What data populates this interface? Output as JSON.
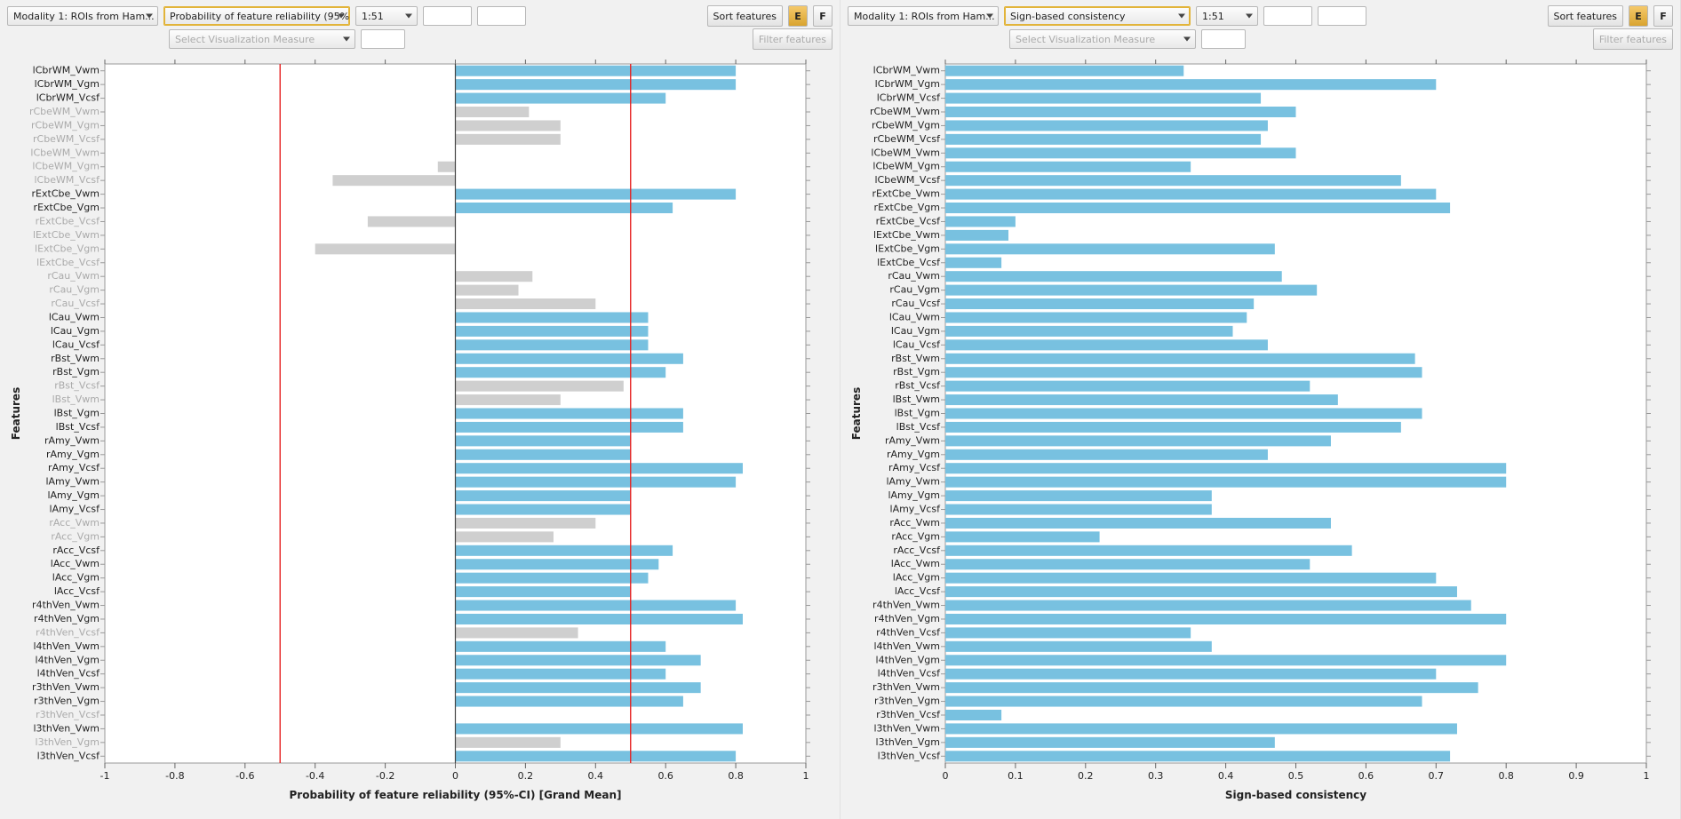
{
  "toolbar": {
    "modality_label": "Modality 1: ROIs from Ham...",
    "range_label": "1:51",
    "sort_label": "Sort features",
    "btn_e": "E",
    "btn_f": "F",
    "viz_measure_placeholder": "Select Visualization Measure",
    "filter_label": "Filter features"
  },
  "panel_left": {
    "measure_label": "Probability of feature reliability (95%...",
    "xlabel": "Probability of feature reliability (95%-CI) [Grand Mean]",
    "ylabel": "Features",
    "thresholds": [
      -0.5,
      0.5
    ]
  },
  "panel_right": {
    "measure_label": "Sign-based consistency",
    "xlabel": "Sign-based consistency",
    "ylabel": "Features"
  },
  "features": [
    "lCbrWM_Vwm",
    "lCbrWM_Vgm",
    "lCbrWM_Vcsf",
    "rCbeWM_Vwm",
    "rCbeWM_Vgm",
    "rCbeWM_Vcsf",
    "lCbeWM_Vwm",
    "lCbeWM_Vgm",
    "lCbeWM_Vcsf",
    "rExtCbe_Vwm",
    "rExtCbe_Vgm",
    "rExtCbe_Vcsf",
    "lExtCbe_Vwm",
    "lExtCbe_Vgm",
    "lExtCbe_Vcsf",
    "rCau_Vwm",
    "rCau_Vgm",
    "rCau_Vcsf",
    "lCau_Vwm",
    "lCau_Vgm",
    "lCau_Vcsf",
    "rBst_Vwm",
    "rBst_Vgm",
    "rBst_Vcsf",
    "lBst_Vwm",
    "lBst_Vgm",
    "lBst_Vcsf",
    "rAmy_Vwm",
    "rAmy_Vgm",
    "rAmy_Vcsf",
    "lAmy_Vwm",
    "lAmy_Vgm",
    "lAmy_Vcsf",
    "rAcc_Vwm",
    "rAcc_Vgm",
    "rAcc_Vcsf",
    "lAcc_Vwm",
    "lAcc_Vgm",
    "lAcc_Vcsf",
    "r4thVen_Vwm",
    "r4thVen_Vgm",
    "r4thVen_Vcsf",
    "l4thVen_Vwm",
    "l4thVen_Vgm",
    "l4thVen_Vcsf",
    "r3thVen_Vwm",
    "r3thVen_Vgm",
    "r3thVen_Vcsf",
    "l3thVen_Vwm",
    "l3thVen_Vgm",
    "l3thVen_Vcsf"
  ],
  "chart_data": [
    {
      "id": "left",
      "type": "bar",
      "orientation": "horizontal",
      "title": "",
      "xlabel": "Probability of feature reliability (95%-CI) [Grand Mean]",
      "ylabel": "Features",
      "xlim": [
        -1,
        1
      ],
      "xticks": [
        -1,
        -0.8,
        -0.6,
        -0.4,
        -0.2,
        0,
        0.2,
        0.4,
        0.6,
        0.8,
        1
      ],
      "reference_lines": [
        -0.5,
        0.5
      ],
      "categories": [
        "lCbrWM_Vwm",
        "lCbrWM_Vgm",
        "lCbrWM_Vcsf",
        "rCbeWM_Vwm",
        "rCbeWM_Vgm",
        "rCbeWM_Vcsf",
        "lCbeWM_Vwm",
        "lCbeWM_Vgm",
        "lCbeWM_Vcsf",
        "rExtCbe_Vwm",
        "rExtCbe_Vgm",
        "rExtCbe_Vcsf",
        "lExtCbe_Vwm",
        "lExtCbe_Vgm",
        "lExtCbe_Vcsf",
        "rCau_Vwm",
        "rCau_Vgm",
        "rCau_Vcsf",
        "lCau_Vwm",
        "lCau_Vgm",
        "lCau_Vcsf",
        "rBst_Vwm",
        "rBst_Vgm",
        "rBst_Vcsf",
        "lBst_Vwm",
        "lBst_Vgm",
        "lBst_Vcsf",
        "rAmy_Vwm",
        "rAmy_Vgm",
        "rAmy_Vcsf",
        "lAmy_Vwm",
        "lAmy_Vgm",
        "lAmy_Vcsf",
        "rAcc_Vwm",
        "rAcc_Vgm",
        "rAcc_Vcsf",
        "lAcc_Vwm",
        "lAcc_Vgm",
        "lAcc_Vcsf",
        "r4thVen_Vwm",
        "r4thVen_Vgm",
        "r4thVen_Vcsf",
        "l4thVen_Vwm",
        "l4thVen_Vgm",
        "l4thVen_Vcsf",
        "r3thVen_Vwm",
        "r3thVen_Vgm",
        "r3thVen_Vcsf",
        "l3thVen_Vwm",
        "l3thVen_Vgm",
        "l3thVen_Vcsf"
      ],
      "values": [
        0.8,
        0.8,
        0.6,
        0.21,
        0.3,
        0.3,
        0.0,
        -0.05,
        -0.35,
        0.8,
        0.62,
        -0.25,
        0.0,
        -0.4,
        0.0,
        0.22,
        0.18,
        0.4,
        0.55,
        0.55,
        0.55,
        0.65,
        0.6,
        0.48,
        0.3,
        0.65,
        0.65,
        0.5,
        0.5,
        0.82,
        0.8,
        0.5,
        0.5,
        0.4,
        0.28,
        0.62,
        0.58,
        0.55,
        0.5,
        0.8,
        0.82,
        0.35,
        0.6,
        0.7,
        0.6,
        0.7,
        0.65,
        0.0,
        0.82,
        0.3,
        0.8
      ]
    },
    {
      "id": "right",
      "type": "bar",
      "orientation": "horizontal",
      "title": "",
      "xlabel": "Sign-based consistency",
      "ylabel": "Features",
      "xlim": [
        0,
        1
      ],
      "xticks": [
        0,
        0.1,
        0.2,
        0.3,
        0.4,
        0.5,
        0.6,
        0.7,
        0.8,
        0.9,
        1
      ],
      "categories": [
        "lCbrWM_Vwm",
        "lCbrWM_Vgm",
        "lCbrWM_Vcsf",
        "rCbeWM_Vwm",
        "rCbeWM_Vgm",
        "rCbeWM_Vcsf",
        "lCbeWM_Vwm",
        "lCbeWM_Vgm",
        "lCbeWM_Vcsf",
        "rExtCbe_Vwm",
        "rExtCbe_Vgm",
        "rExtCbe_Vcsf",
        "lExtCbe_Vwm",
        "lExtCbe_Vgm",
        "lExtCbe_Vcsf",
        "rCau_Vwm",
        "rCau_Vgm",
        "rCau_Vcsf",
        "lCau_Vwm",
        "lCau_Vgm",
        "lCau_Vcsf",
        "rBst_Vwm",
        "rBst_Vgm",
        "rBst_Vcsf",
        "lBst_Vwm",
        "lBst_Vgm",
        "lBst_Vcsf",
        "rAmy_Vwm",
        "rAmy_Vgm",
        "rAmy_Vcsf",
        "lAmy_Vwm",
        "lAmy_Vgm",
        "lAmy_Vcsf",
        "rAcc_Vwm",
        "rAcc_Vgm",
        "rAcc_Vcsf",
        "lAcc_Vwm",
        "lAcc_Vgm",
        "lAcc_Vcsf",
        "r4thVen_Vwm",
        "r4thVen_Vgm",
        "r4thVen_Vcsf",
        "l4thVen_Vwm",
        "l4thVen_Vgm",
        "l4thVen_Vcsf",
        "r3thVen_Vwm",
        "r3thVen_Vgm",
        "r3thVen_Vcsf",
        "l3thVen_Vwm",
        "l3thVen_Vgm",
        "l3thVen_Vcsf"
      ],
      "values": [
        0.34,
        0.7,
        0.45,
        0.5,
        0.46,
        0.45,
        0.5,
        0.35,
        0.65,
        0.7,
        0.72,
        0.1,
        0.09,
        0.47,
        0.08,
        0.48,
        0.53,
        0.44,
        0.43,
        0.41,
        0.46,
        0.67,
        0.68,
        0.52,
        0.56,
        0.68,
        0.65,
        0.55,
        0.46,
        0.8,
        0.8,
        0.38,
        0.38,
        0.55,
        0.22,
        0.58,
        0.52,
        0.7,
        0.73,
        0.75,
        0.8,
        0.35,
        0.38,
        0.8,
        0.7,
        0.76,
        0.68,
        0.08,
        0.73,
        0.47,
        0.72
      ]
    }
  ]
}
